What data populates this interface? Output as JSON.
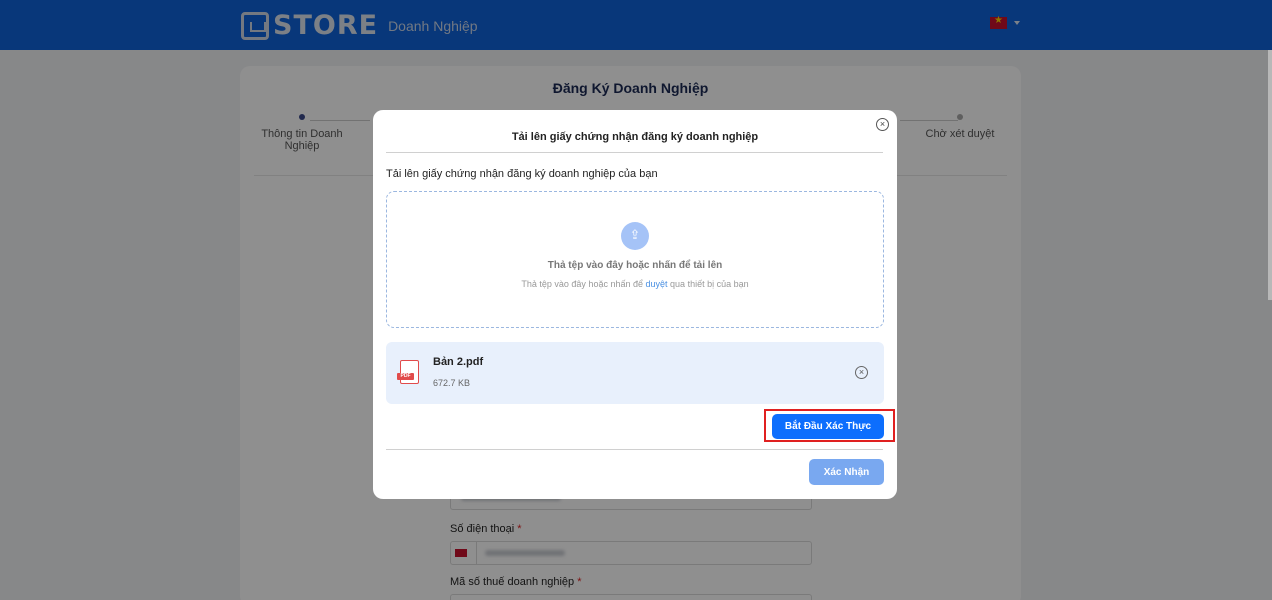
{
  "header": {
    "logo_text": "STORE",
    "logo_sub": "Doanh Nghiệp",
    "language_flag": "vn-flag-icon"
  },
  "page": {
    "title": "Đăng Ký Doanh Nghiệp",
    "steps": [
      {
        "label": "Thông tin Doanh Nghiệp",
        "active": true
      },
      {
        "label": "Chờ xét duyệt",
        "active": false
      }
    ],
    "fields": [
      {
        "label": "Số điện thoại",
        "required": "*"
      },
      {
        "label": "Mã số thuế doanh nghiệp",
        "required": "*"
      }
    ]
  },
  "modal": {
    "title": "Tải lên giấy chứng nhận đăng ký doanh nghiệp",
    "upload_label": "Tải lên giấy chứng nhận đăng ký doanh nghiệp của bạn",
    "dropzone": {
      "main_text": "Thả tệp vào đây hoặc nhấn để tải lên",
      "sub_prefix": "Thả tệp vào đây hoặc nhấn để",
      "sub_link": "duyệt",
      "sub_suffix": "qua thiết bị của bạn"
    },
    "file": {
      "name": "Bản 2.pdf",
      "size": "672.7 KB",
      "badge": "PDF"
    },
    "verify_button": "Bắt Đầu Xác Thực",
    "confirm_button": "Xác Nhận",
    "close_glyph": "×",
    "remove_glyph": "×"
  },
  "colors": {
    "header": "#0f62d9",
    "primary": "#0d6efd",
    "highlight": "#e02020"
  }
}
